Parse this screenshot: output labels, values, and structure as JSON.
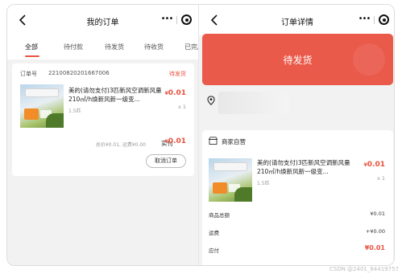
{
  "left": {
    "nav_title": "我的订单",
    "capsule_more": "•••",
    "tabs": [
      {
        "label": "全部",
        "active": true
      },
      {
        "label": "待付款",
        "active": false
      },
      {
        "label": "待发货",
        "active": false
      },
      {
        "label": "待收货",
        "active": false
      },
      {
        "label": "已完成",
        "active": false
      }
    ],
    "order": {
      "order_no_label": "订单号",
      "order_no": "22100820201667006",
      "status": "待发货",
      "product_title": "美的(请勿支付)3匹新风空调新风量210㎥/h焕新风新一级变...",
      "spec": "1.5匹",
      "price_symbol": "¥",
      "price": "0.01",
      "qty": "x 1",
      "summary": "总价¥0.01, 运费¥0.00",
      "paid_label": "实付",
      "paid_symbol": "¥",
      "paid_amount": "0.01",
      "cancel_label": "取消订单"
    }
  },
  "right": {
    "nav_title": "订单详情",
    "capsule_more": "•••",
    "status_text": "待发货",
    "store_name": "商家自营",
    "product_title": "美的(请勿支付)3匹新风空调新风量210㎥/h焕新风新一级变...",
    "spec": "1.5匹",
    "price_symbol": "¥",
    "price": "0.01",
    "qty": "x 1",
    "fees": {
      "goods_total_label": "商品总额",
      "goods_total": "¥0.01",
      "shipping_label": "运费",
      "shipping": "+¥0.00",
      "payable_label": "应付",
      "payable": "¥0.01"
    }
  },
  "watermark": "CSDN @2401_84419757",
  "colors": {
    "accent": "#e8523f",
    "banner": "#ea5a4a",
    "bg": "#f2f2f2"
  }
}
